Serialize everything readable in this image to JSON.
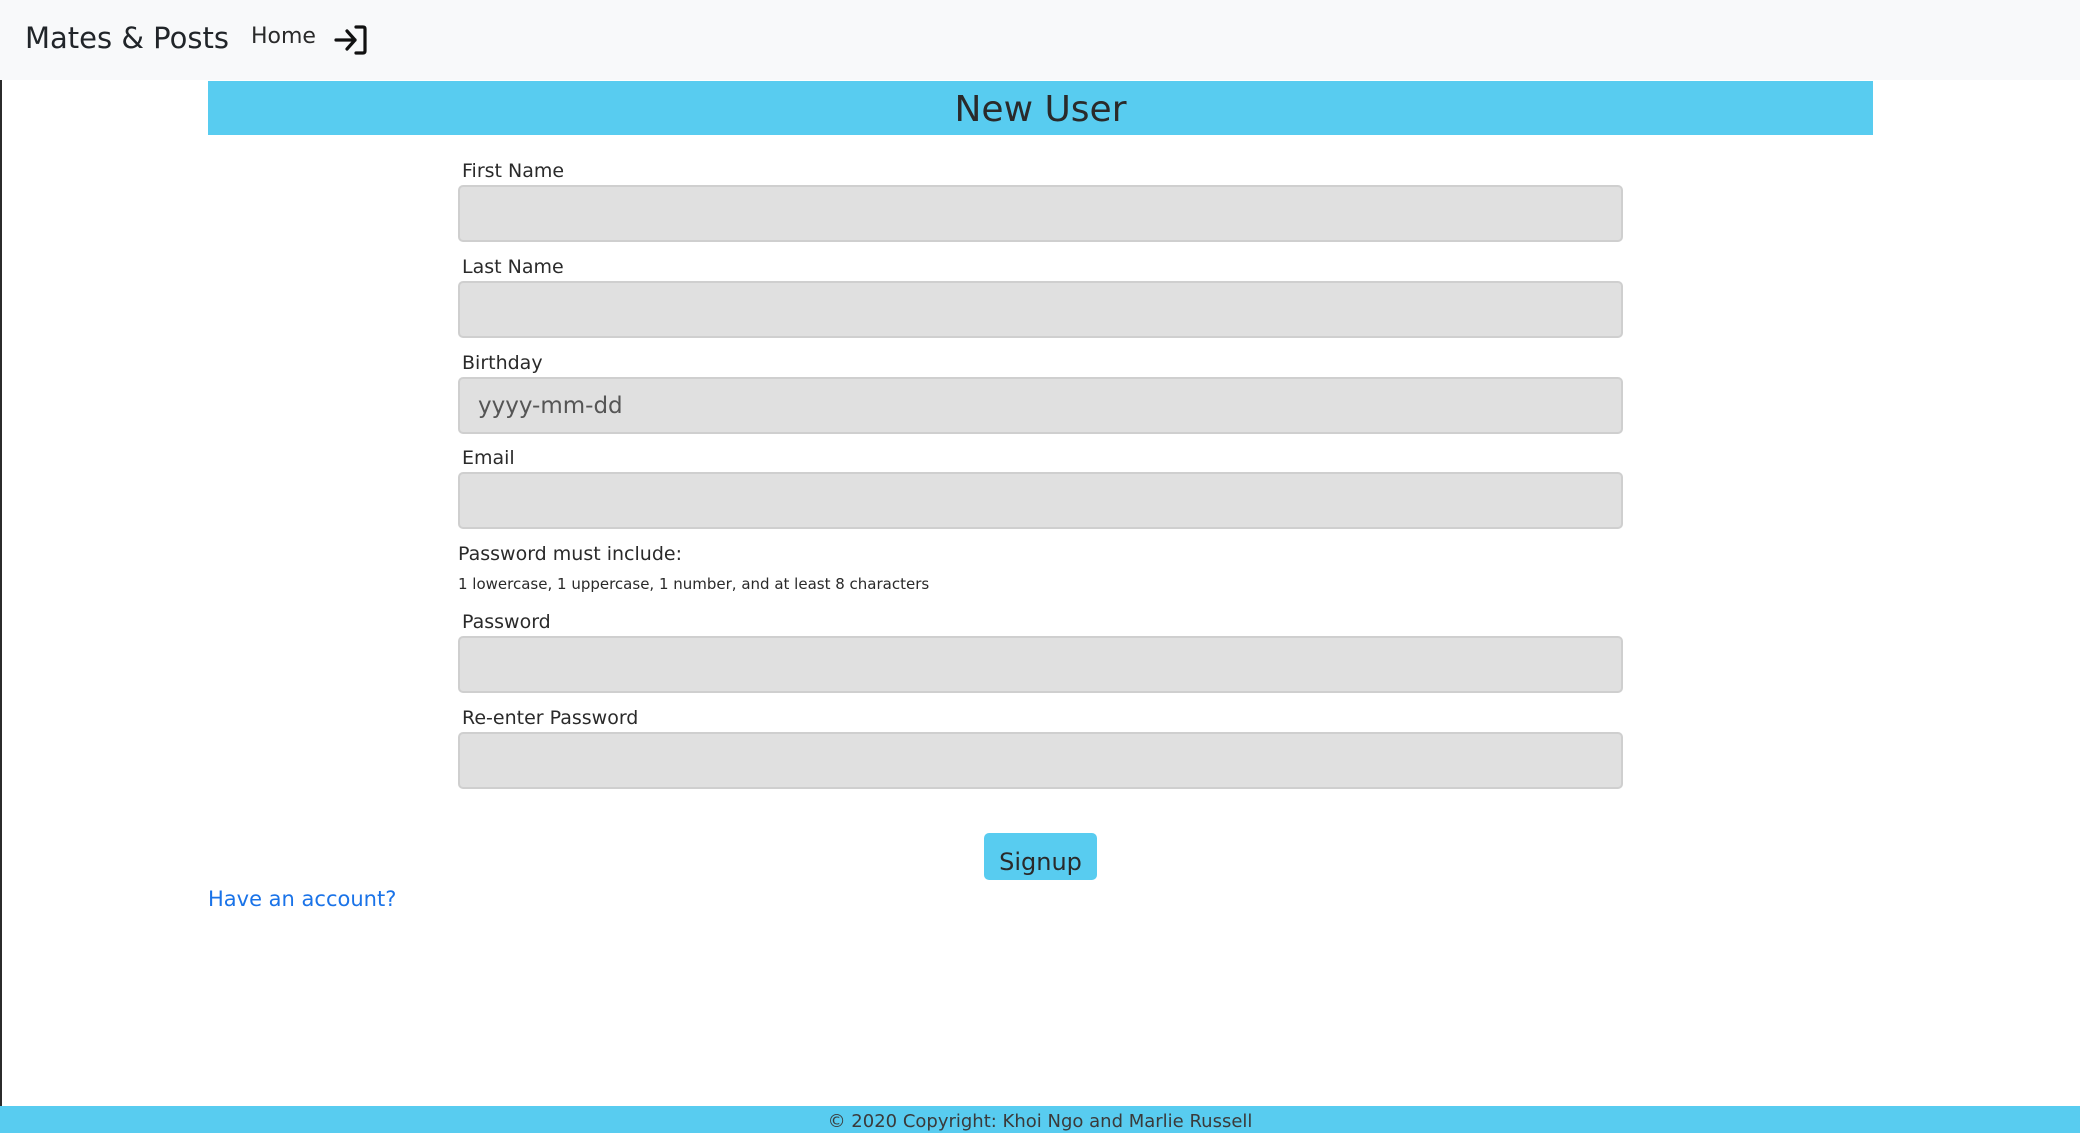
{
  "navbar": {
    "brand": "Mates & Posts",
    "home_label": "Home",
    "login_icon": "login-arrow-icon"
  },
  "banner": {
    "title": "New User"
  },
  "form": {
    "first_name": {
      "label": "First Name",
      "value": "",
      "placeholder": ""
    },
    "last_name": {
      "label": "Last Name",
      "value": "",
      "placeholder": ""
    },
    "birthday": {
      "label": "Birthday",
      "value": "",
      "placeholder": "yyyy-mm-dd"
    },
    "email": {
      "label": "Email",
      "value": "",
      "placeholder": ""
    },
    "password_rules": {
      "title": "Password must include:",
      "text": "1 lowercase, 1 uppercase, 1 number, and at least 8 characters"
    },
    "password": {
      "label": "Password",
      "value": "",
      "placeholder": ""
    },
    "reenter_password": {
      "label": "Re-enter Password",
      "value": "",
      "placeholder": ""
    },
    "submit_label": "Signup"
  },
  "account_link": "Have an account?",
  "footer": {
    "text": "© 2020 Copyright: Khoi Ngo and Marlie Russell"
  },
  "colors": {
    "accent": "#58ccf0",
    "navbar_bg": "#f8f9fa",
    "input_bg": "#e0e0e0",
    "link": "#1a73e8"
  }
}
